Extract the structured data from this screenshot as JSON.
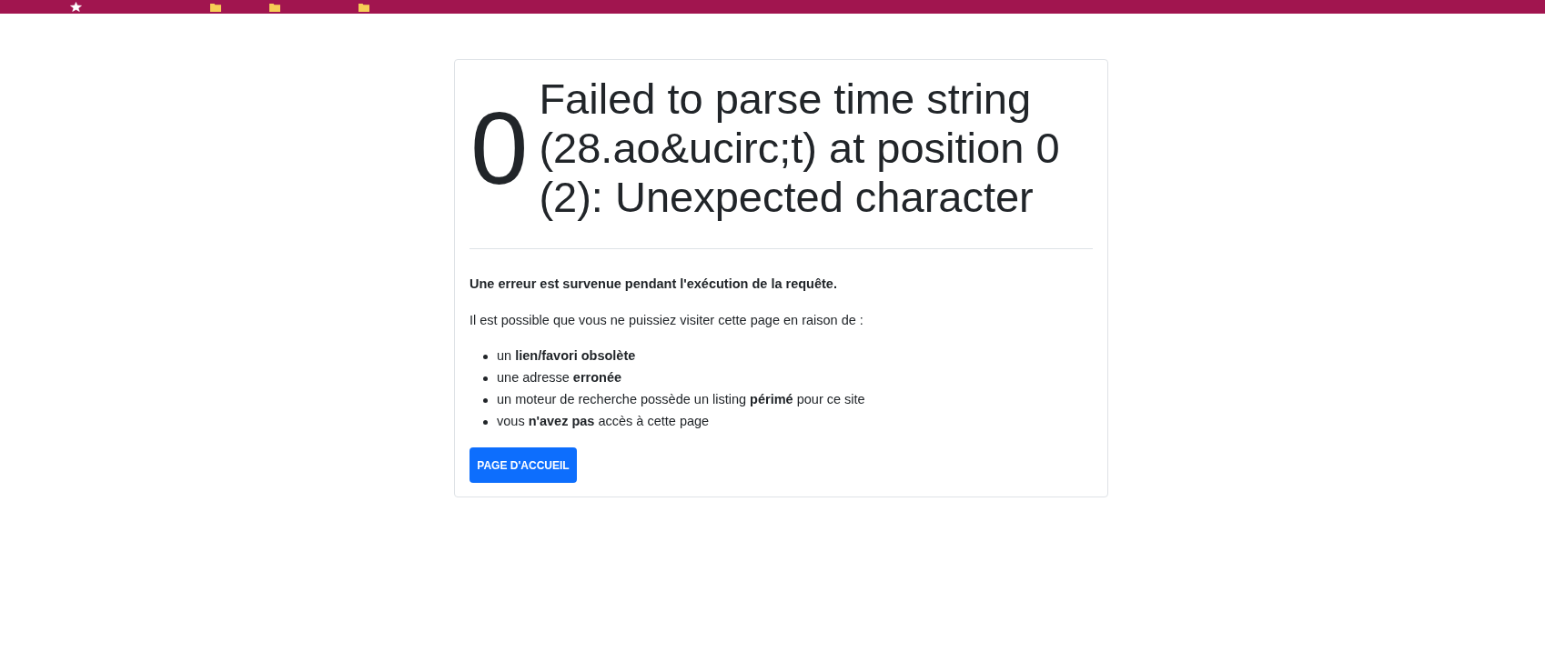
{
  "error": {
    "code": "0",
    "message": "Failed to parse time string (28.ao&ucirc;t) at position 0 (2): Unexpected character",
    "summary": "Une erreur est survenue pendant l'exécution de la requête.",
    "intro": "Il est possible que vous ne puissiez visiter cette page en raison de :",
    "reasons": [
      "un **lien/favori obsolète**",
      "une adresse **erronée**",
      "un moteur de recherche possède un listing **périmé** pour ce site",
      "vous **n'avez pas** accès à cette page"
    ],
    "button": "PAGE D'ACCUEIL"
  }
}
